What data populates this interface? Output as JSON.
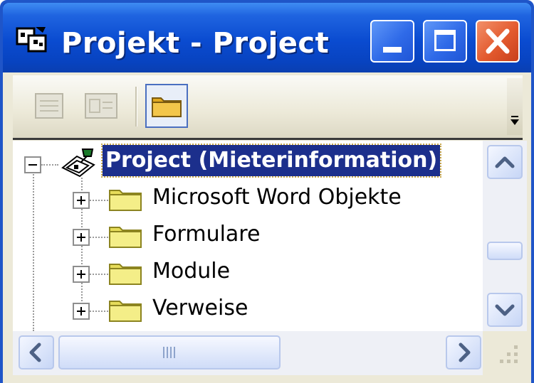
{
  "window": {
    "title": "Projekt - Project",
    "icon": "vba-project-icon"
  },
  "title_buttons": [
    "minimize-icon",
    "maximize-icon",
    "close-icon"
  ],
  "toolbar": {
    "buttons": [
      "view-code-icon",
      "view-object-icon",
      "toggle-folders-icon"
    ]
  },
  "tree": {
    "root": {
      "label": "Project (Mieterinformation)",
      "expanded": true,
      "selected": true
    },
    "children": [
      {
        "label": "Microsoft Word Objekte",
        "expanded": false
      },
      {
        "label": "Formulare",
        "expanded": false
      },
      {
        "label": "Module",
        "expanded": false
      },
      {
        "label": "Verweise",
        "expanded": false
      }
    ]
  },
  "colors": {
    "titlebar": "#0a4bd0",
    "selection": "#1c2f8c",
    "folder": "#f1ea7a",
    "close_button": "#e35a2e"
  }
}
